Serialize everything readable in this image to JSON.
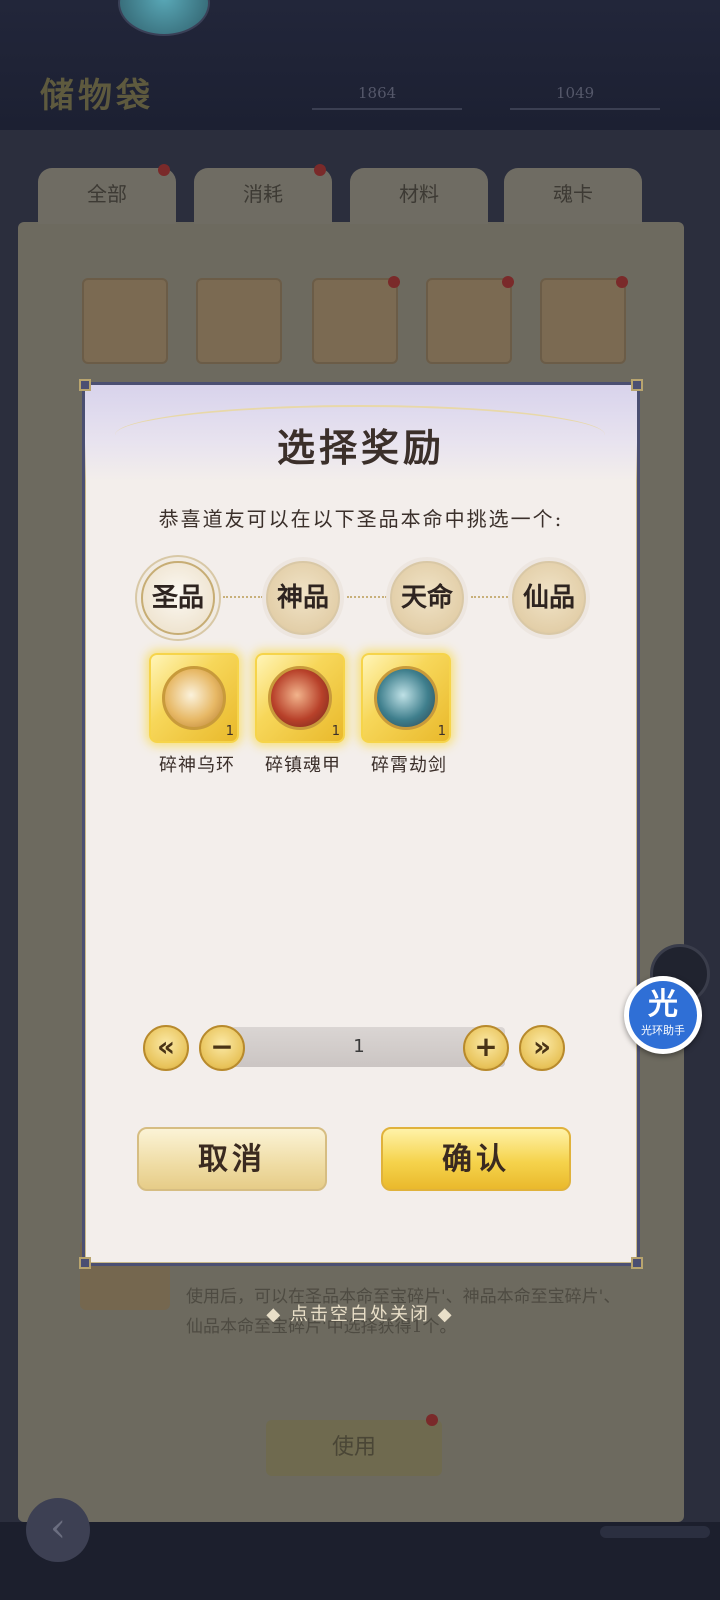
{
  "background": {
    "page_title": "储物袋",
    "currency1": "1864",
    "currency2": "1049",
    "tabs": [
      "全部",
      "消耗",
      "材料",
      "魂卡"
    ],
    "description": "使用后，可以在圣品本命至宝碎片'、神品本命至宝碎片'、仙品本命至宝碎片'中选择获得1个。",
    "use_button": "使用"
  },
  "close_hint": "◆ 点击空白处关闭 ◆",
  "helper": {
    "glyph": "光",
    "label": "光环助手"
  },
  "dialog": {
    "title": "选择奖励",
    "subtitle": "恭喜道友可以在以下圣品本命中挑选一个:",
    "tiers": [
      "圣品",
      "神品",
      "天命",
      "仙品"
    ],
    "active_tier": "圣品",
    "rewards": [
      {
        "name": "碎神乌环",
        "count": "1"
      },
      {
        "name": "碎镇魂甲",
        "count": "1"
      },
      {
        "name": "碎霄劫剑",
        "count": "1"
      }
    ],
    "stepper": {
      "value": "1",
      "first": "«",
      "minus": "−",
      "plus": "+",
      "last": "»"
    },
    "cancel_label": "取消",
    "confirm_label": "确认"
  }
}
